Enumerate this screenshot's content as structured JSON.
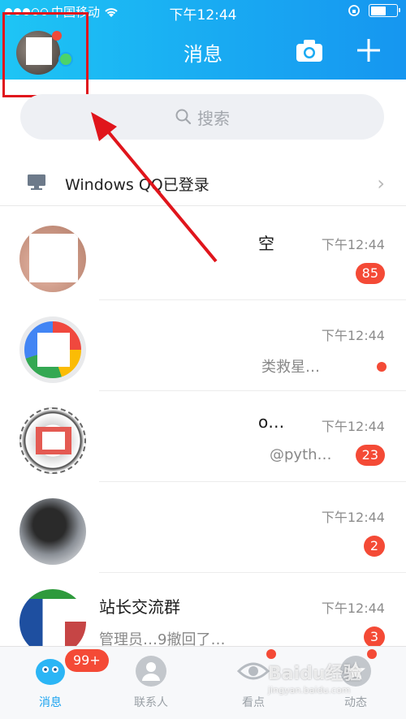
{
  "status_bar": {
    "carrier": "中国移动",
    "time": "下午12:44"
  },
  "header": {
    "title": "消息"
  },
  "search": {
    "placeholder": "搜索"
  },
  "login_banner": {
    "text": "Windows QQ已登录"
  },
  "chats": [
    {
      "name": "空",
      "time": "下午12:44",
      "message": "",
      "badge": "85"
    },
    {
      "name": "",
      "time": "下午12:44",
      "message": "类救星…",
      "badge": ""
    },
    {
      "name": "o…",
      "time": "下午12:44",
      "message": "@pyth…",
      "badge": "23"
    },
    {
      "name": "",
      "time": "下午12:44",
      "message": "",
      "badge": "2"
    },
    {
      "name": "站长交流群",
      "time": "下午12:44",
      "message": "管理员…9撤回了…",
      "badge": "3"
    }
  ],
  "tabbar": {
    "tabs": [
      {
        "label": "消息"
      },
      {
        "label": "联系人"
      },
      {
        "label": "看点"
      },
      {
        "label": "动态"
      }
    ],
    "messages_badge": "99+"
  },
  "watermark": {
    "text": "Baidu经验",
    "sub": "jingyan.baidu.com"
  },
  "colors": {
    "header_gradient_start": "#1ec5f5",
    "header_gradient_end": "#1696f0",
    "badge_red": "#f44a36",
    "active_tab": "#1aa3f0",
    "highlight_red": "#e0151c"
  }
}
